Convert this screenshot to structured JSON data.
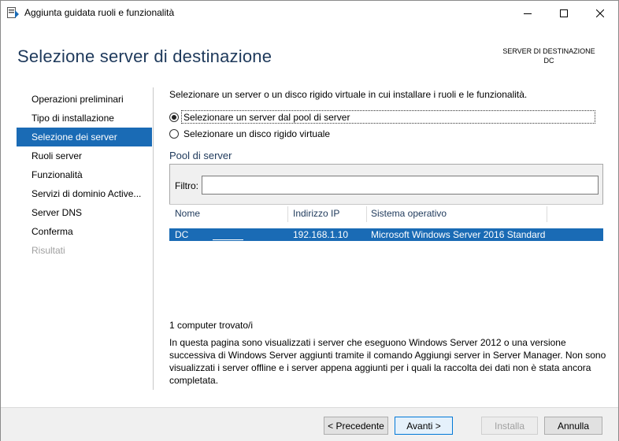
{
  "window": {
    "title": "Aggiunta guidata ruoli e funzionalità"
  },
  "header": {
    "page_title": "Selezione server di destinazione",
    "destination_label": "SERVER DI DESTINAZIONE",
    "destination_value": "DC"
  },
  "sidebar": {
    "items": [
      {
        "label": "Operazioni preliminari",
        "state": "normal"
      },
      {
        "label": "Tipo di installazione",
        "state": "normal"
      },
      {
        "label": "Selezione dei server",
        "state": "active"
      },
      {
        "label": "Ruoli server",
        "state": "normal"
      },
      {
        "label": "Funzionalità",
        "state": "normal"
      },
      {
        "label": "Servizi di dominio Active...",
        "state": "normal"
      },
      {
        "label": "Server DNS",
        "state": "normal"
      },
      {
        "label": "Conferma",
        "state": "normal"
      },
      {
        "label": "Risultati",
        "state": "disabled"
      }
    ]
  },
  "main": {
    "intro": "Selezionare un server o un disco rigido virtuale in cui installare i ruoli e le funzionalità.",
    "options": [
      {
        "label": "Selezionare un server dal pool di server",
        "checked": true
      },
      {
        "label": "Selezionare un disco rigido virtuale",
        "checked": false
      }
    ],
    "pool_title": "Pool di server",
    "filter_label": "Filtro:",
    "filter_value": "",
    "columns": [
      "Nome",
      "Indirizzo IP",
      "Sistema operativo"
    ],
    "rows": [
      {
        "name": "DC",
        "ip": "192.168.1.10",
        "os": "Microsoft Windows Server 2016 Standard",
        "selected": true
      }
    ],
    "found_text": "1 computer trovato/i",
    "info_text": "In questa pagina sono visualizzati i server che eseguono Windows Server 2012 o una versione successiva di Windows Server aggiunti tramite il comando Aggiungi server in Server Manager. Non sono visualizzati i server offline e i server appena aggiunti per i quali la raccolta dei dati non è stata ancora completata."
  },
  "footer": {
    "prev_label": "< Precedente",
    "next_label": "Avanti >",
    "install_label": "Installa",
    "cancel_label": "Annulla"
  },
  "colors": {
    "accent": "#1a6bb5",
    "title_blue": "#1e395b"
  }
}
